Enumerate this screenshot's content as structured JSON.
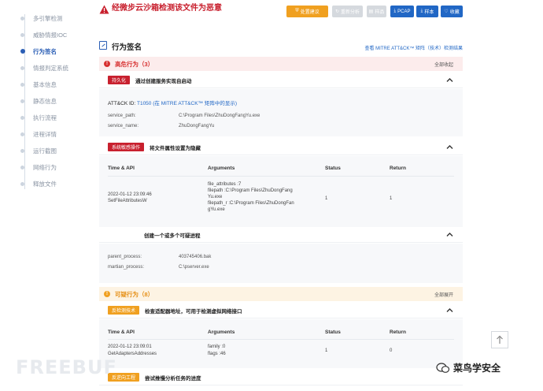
{
  "sidebar": {
    "items": [
      {
        "label": "多引擎检测",
        "active": false
      },
      {
        "label": "威胁情报IOC",
        "active": false
      },
      {
        "label": "行为签名",
        "active": true
      },
      {
        "label": "情报判定系统",
        "active": false
      },
      {
        "label": "基本信息",
        "active": false
      },
      {
        "label": "静态信息",
        "active": false
      },
      {
        "label": "执行流程",
        "active": false
      },
      {
        "label": "进程详情",
        "active": false
      },
      {
        "label": "运行截图",
        "active": false
      },
      {
        "label": "网络行为",
        "active": false
      },
      {
        "label": "释放文件",
        "active": false
      }
    ]
  },
  "header": {
    "title": "经微步云沙箱检测该文件为恶意",
    "buttons": {
      "solution": "处置建议",
      "reanalyze": "重新分析",
      "sample": "样品",
      "pcap": "PCAP",
      "download_sample": "样本",
      "favorite": "收藏"
    }
  },
  "section": {
    "title": "行为签名",
    "attck_link": "查看 MITRE ATT&CK™ 矩阵（技术）检测结果"
  },
  "high_risk": {
    "title": "高危行为（3）",
    "action": "全部收起",
    "items": [
      {
        "tag": "持久化",
        "desc": "通过创建服务实现自启动",
        "attck_label": "ATT&CK ID:",
        "attck_id": "T1050",
        "attck_link": "(在 MITRE ATT&CK™ 矩阵中的显示)",
        "kv": [
          {
            "key": "service_path:",
            "value": "C:\\Program Files\\ZhuDongFangYu.exe"
          },
          {
            "key": "service_name:",
            "value": "ZhuDongFangYu"
          }
        ]
      },
      {
        "tag": "系统敏感操作",
        "desc": "将文件属性设置为隐藏",
        "headers": [
          "Time & API",
          "Arguments",
          "Status",
          "Return"
        ],
        "row": {
          "time": "2022-01-12 23:09:46",
          "api": "SetFileAttributesW",
          "args": [
            "file_attributes :7",
            "filepath :C:\\Program Files\\ZhuDongFang",
            "Yu.exe",
            "filepath_r :C:\\Program Files\\ZhuDongFan",
            "gYu.exe"
          ],
          "status": "1",
          "return": "1"
        }
      },
      {
        "tag": "",
        "desc": "创建一个或多个可疑进程",
        "kv": [
          {
            "key": "parent_process:",
            "value": "403745406.bak"
          },
          {
            "key": "martian_process:",
            "value": "C:\\pserver.exe"
          }
        ]
      }
    ]
  },
  "suspicious": {
    "title": "可疑行为（8）",
    "action": "全部展开",
    "items": [
      {
        "tag": "反检测技术",
        "desc": "检查适配器地址，可用于检测虚拟网络接口",
        "headers": [
          "Time & API",
          "Arguments",
          "Status",
          "Return"
        ],
        "row": {
          "time": "2022-01-12 23:09:01",
          "api": "GetAdaptersAddresses",
          "args": [
            "family :0",
            "flags :46"
          ],
          "status": "1",
          "return": "0"
        }
      },
      {
        "tag": "反逆向工程",
        "desc": "尝试推慢分析任务的进度"
      }
    ]
  },
  "watermark": {
    "left": "FREEBUF",
    "right": "菜鸟学安全"
  },
  "colors": {
    "accent": "#2167c5",
    "danger": "#c8202e",
    "warning": "#f0a020"
  }
}
